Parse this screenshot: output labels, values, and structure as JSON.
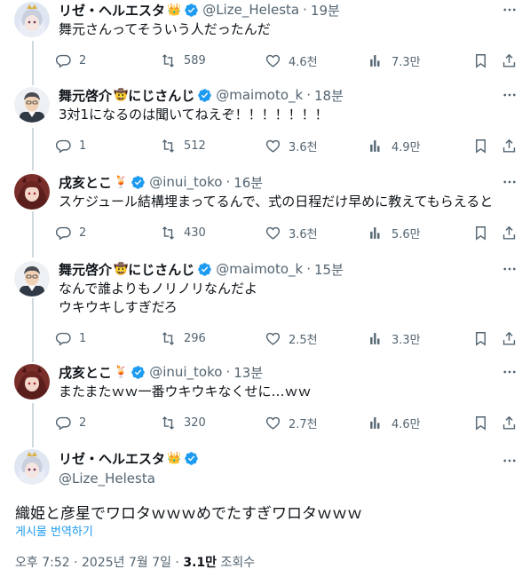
{
  "tweets": [
    {
      "name": "リゼ・ヘルエスタ",
      "emoji": "👑",
      "handle": "@Lize_Helesta",
      "time": "19분",
      "lines": [
        "舞元さんってそういう人だったんだ"
      ],
      "replies": "2",
      "retweets": "589",
      "likes": "4.6천",
      "views": "7.3만",
      "avatar": "lize"
    },
    {
      "name": "舞元啓介",
      "emoji": "🤠",
      "name_suffix": "にじさんじ",
      "handle": "@maimoto_k",
      "time": "18분",
      "lines": [
        "3対1になるのは聞いてねえぞ！！！！！！！"
      ],
      "replies": "1",
      "retweets": "512",
      "likes": "3.6천",
      "views": "4.9만",
      "avatar": "maimoto"
    },
    {
      "name": "戌亥とこ",
      "emoji": "🍹",
      "handle": "@inui_toko",
      "time": "16분",
      "lines": [
        "スケジュール結構埋まってるんで、式の日程だけ早めに教えてもらえると"
      ],
      "replies": "2",
      "retweets": "430",
      "likes": "3.6천",
      "views": "5.6만",
      "avatar": "inui"
    },
    {
      "name": "舞元啓介",
      "emoji": "🤠",
      "name_suffix": "にじさんじ",
      "handle": "@maimoto_k",
      "time": "15분",
      "lines": [
        "なんで誰よりもノリノリなんだよ",
        "ウキウキしすぎだろ"
      ],
      "replies": "1",
      "retweets": "296",
      "likes": "2.5천",
      "views": "3.3만",
      "avatar": "maimoto"
    },
    {
      "name": "戌亥とこ",
      "emoji": "🍹",
      "handle": "@inui_toko",
      "time": "13분",
      "lines": [
        "またまたｗｗ一番ウキウキなくせに…ｗｗ"
      ],
      "replies": "2",
      "retweets": "320",
      "likes": "2.7천",
      "views": "4.6만",
      "avatar": "inui"
    }
  ],
  "main_tweet": {
    "name": "リゼ・ヘルエスタ",
    "emoji": "👑",
    "handle": "@Lize_Helesta",
    "text": "織姫と彦星でワロタｗｗｗめでたすぎワロタｗｗｗ",
    "translate": "게시물 번역하기",
    "time": "오후 7:52 · 2025년 7월 7일 · ",
    "views": "3.1만",
    "views_label": " 조회수"
  },
  "colors": {
    "accent": "#1d9bf0",
    "muted": "#536471",
    "line": "#cfd9de"
  }
}
